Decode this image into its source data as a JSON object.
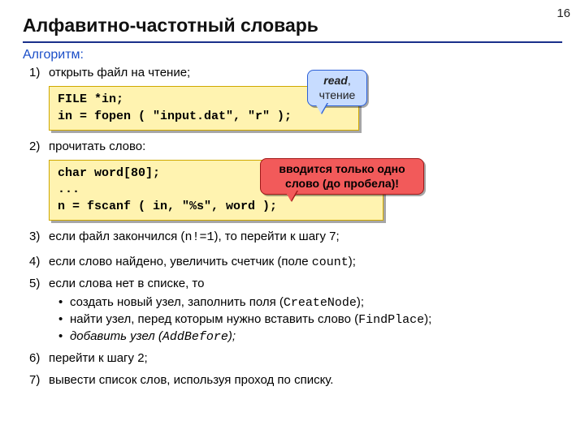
{
  "page_number": "16",
  "title": "Алфавитно-частотный словарь",
  "algo_label": "Алгоритм:",
  "step1": {
    "num": "1)",
    "text": "открыть файл на чтение;"
  },
  "code1": "FILE *in;\nin = fopen ( \"input.dat\", \"r\" );",
  "callout_read_strong": "read",
  "callout_read_rest": ", чтение",
  "step2": {
    "num": "2)",
    "text": "прочитать слово:"
  },
  "code2": "char word[80];\n...\nn = fscanf ( in, \"%s\", word );",
  "callout_red_l1": "вводится только одно",
  "callout_red_l2": "слово (до пробела)!",
  "step3": {
    "num": "3)",
    "pre": "если файл закончился (",
    "code": "n!=1",
    "post": "), то перейти к шагу 7;"
  },
  "step4": {
    "num": "4)",
    "pre": "если слово найдено, увеличить счетчик (поле ",
    "code": "count",
    "post": ");"
  },
  "step5": {
    "num": "5)",
    "text": "если слова нет в списке, то"
  },
  "step5a": {
    "pre": "создать новый узел, заполнить поля (",
    "code": "CreateNode",
    "post": ");"
  },
  "step5b": {
    "pre": "найти узел, перед которым нужно вставить слово (",
    "code": "FindPlace",
    "post": ");"
  },
  "step5c": {
    "pre_it": "добавить узел (",
    "code": "AddBefore",
    "post_it": ");"
  },
  "step6": {
    "num": "6)",
    "text": "перейти к шагу 2;"
  },
  "step7": {
    "num": "7)",
    "text": "вывести список слов, используя проход по списку."
  }
}
